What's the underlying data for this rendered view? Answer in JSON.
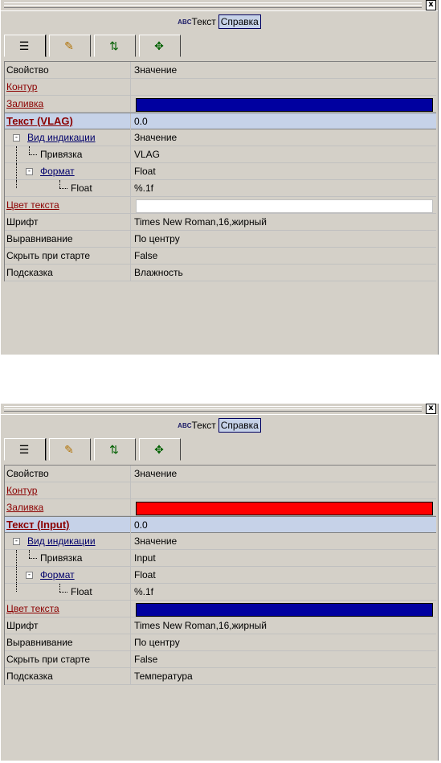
{
  "panels": [
    {
      "close_label": "x",
      "object_icon": "ABC",
      "object_name": "Текст",
      "help_label": "Справка",
      "tabs": [
        {
          "icon": "list-icon",
          "glyph": "☰"
        },
        {
          "icon": "paint-icon",
          "glyph": "✎"
        },
        {
          "icon": "events-icon",
          "glyph": "⇅"
        },
        {
          "icon": "move-icon",
          "glyph": "✥"
        }
      ],
      "header": {
        "property": "Свойство",
        "value": "Значение"
      },
      "rows": [
        {
          "property": "Контур",
          "value": ""
        },
        {
          "property": "Заливка",
          "value": "",
          "swatch": "#0000a0"
        },
        {
          "property": "Текст (VLAG)",
          "value": "0.0"
        },
        {
          "property": "Вид индикации",
          "value": "Значение"
        },
        {
          "property": "Привязка",
          "value": "VLAG"
        },
        {
          "property": "Формат",
          "value": "Float"
        },
        {
          "property": "Float",
          "value": "%.1f"
        },
        {
          "property": "Цвет текста",
          "value": "",
          "swatch": "#ffffff"
        },
        {
          "property": "Шрифт",
          "value": "Times New Roman,16,жирный"
        },
        {
          "property": "Выравнивание",
          "value": "По центру"
        },
        {
          "property": "Скрыть при старте",
          "value": "False"
        },
        {
          "property": "Подсказка",
          "value": "Влажность"
        }
      ]
    },
    {
      "close_label": "x",
      "object_icon": "ABC",
      "object_name": "Текст",
      "help_label": "Справка",
      "tabs": [
        {
          "icon": "list-icon",
          "glyph": "☰"
        },
        {
          "icon": "paint-icon",
          "glyph": "✎"
        },
        {
          "icon": "events-icon",
          "glyph": "⇅"
        },
        {
          "icon": "move-icon",
          "glyph": "✥"
        }
      ],
      "header": {
        "property": "Свойство",
        "value": "Значение"
      },
      "rows": [
        {
          "property": "Контур",
          "value": ""
        },
        {
          "property": "Заливка",
          "value": "",
          "swatch": "#ff0000"
        },
        {
          "property": "Текст (Input)",
          "value": "0.0"
        },
        {
          "property": "Вид индикации",
          "value": "Значение"
        },
        {
          "property": "Привязка",
          "value": "Input"
        },
        {
          "property": "Формат",
          "value": "Float"
        },
        {
          "property": "Float",
          "value": "%.1f"
        },
        {
          "property": "Цвет текста",
          "value": "",
          "swatch": "#0000a0"
        },
        {
          "property": "Шрифт",
          "value": "Times New Roman,16,жирный"
        },
        {
          "property": "Выравнивание",
          "value": "По центру"
        },
        {
          "property": "Скрыть при старте",
          "value": "False"
        },
        {
          "property": "Подсказка",
          "value": "Температура"
        }
      ]
    }
  ]
}
